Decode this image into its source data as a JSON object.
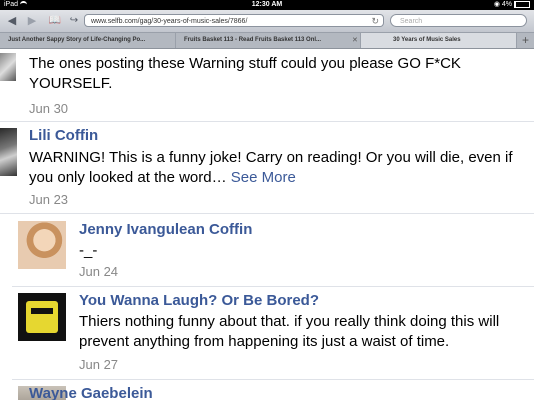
{
  "statusbar": {
    "device": "iPad",
    "time": "12:30 AM",
    "battery": "4%"
  },
  "toolbar": {
    "url": "www.selfb.com/gag/30-years-of-music-sales/7866/",
    "search_placeholder": "Search"
  },
  "tabs": [
    {
      "label": "Just Another Sappy Story of Life-Changing Po..."
    },
    {
      "label": "Fruits Basket 113 - Read Fruits Basket 113 Onl..."
    },
    {
      "label": "30 Years of Music Sales"
    }
  ],
  "comments": [
    {
      "text": "The ones posting these Warning stuff could you please GO F*CK YOURSELF.",
      "date": "Jun 30"
    },
    {
      "name": "Lili Coffin",
      "text": "WARNING! This is a funny joke! Carry on reading! Or you will die, even if you only looked at the word…",
      "see_more": "See More",
      "date": "Jun 23"
    },
    {
      "name": "Jenny Ivangulean Coffin",
      "text": "-_-",
      "date": "Jun 24"
    },
    {
      "name": "You Wanna Laugh? Or Be Bored?",
      "text": "Thiers nothing funny about that. if you really think doing this will prevent anything from happening its just a waist of time.",
      "date": "Jun 27"
    },
    {
      "name": "Wayne Gaebelein"
    }
  ]
}
